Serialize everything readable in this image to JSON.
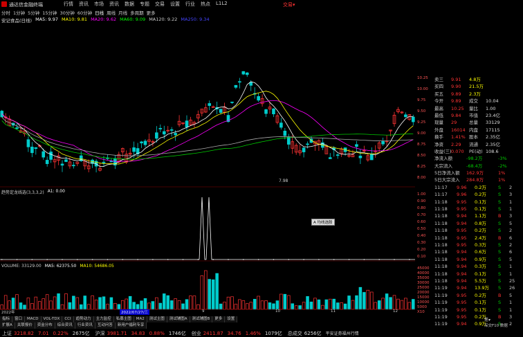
{
  "titlebar": {
    "app_title": "通达信金融终端",
    "trade": "交易▾"
  },
  "menu": {
    "items": [
      "行情",
      "资讯",
      "市场",
      "资讯",
      "数据",
      "专题",
      "交易",
      "设置",
      "行业",
      "热点",
      "L1L2"
    ]
  },
  "periods": [
    "分时",
    "1分钟",
    "5分钟",
    "15分钟",
    "30分钟",
    "60分钟",
    "日线",
    "周线",
    "月线",
    "多周期",
    "更多"
  ],
  "stock_info": {
    "name": "安记食品(日线)",
    "ma5": "MA5: 9.97",
    "ma10": "MA10: 9.81",
    "ma20": "MA20: 9.62",
    "ma60": "MA60: 9.09",
    "ma120": "MA120: 9.22",
    "ma250": "MA250: 9.34"
  },
  "indicator": {
    "title": "趋势定龙线选(3,3,3,2)",
    "a1": "A1: 0.00",
    "btn": "A 均线选股"
  },
  "volume": {
    "title": "VOLUME: 33129.00",
    "ma5": "MA5: 62375.50",
    "ma10": "MA10: 54686.05"
  },
  "chart_labels": {
    "low": "7.98",
    "date_tag": "2022/07/27/三",
    "year": "2022年",
    "m9": "9",
    "m10": "10",
    "m11": "11",
    "m12": "12"
  },
  "right_panel": {
    "ask": [
      {
        "l": "卖三",
        "p": "9.91",
        "v": "4.8万"
      },
      {
        "l": "买四",
        "p": "9.90",
        "v": "21.5万"
      },
      {
        "l": "买五",
        "p": "9.89",
        "v": "2.3万"
      }
    ],
    "info": [
      {
        "l": "今开",
        "v": "9.89",
        "l2": "成交",
        "v2": "10.04"
      },
      {
        "l": "最高",
        "v": "10.25",
        "l2": "量比",
        "v2": "1.00"
      },
      {
        "l": "最低",
        "v": "9.84",
        "l2": "市值",
        "v2": "23.4亿"
      },
      {
        "l": "现量",
        "v": "29",
        "l2": "总量",
        "v2": "33129"
      },
      {
        "l": "外盘",
        "v": "16014",
        "l2": "内盘",
        "v2": "17115"
      },
      {
        "l": "换手",
        "v": "1.41%",
        "l2": "股本",
        "v2": "2.35亿"
      },
      {
        "l": "净资",
        "v": "2.29",
        "l2": "流通",
        "v2": "2.35亿"
      },
      {
        "l": "收益(三)",
        "v": "0.070",
        "l2": "PE(动)",
        "v2": "108.6"
      }
    ],
    "flow": [
      {
        "l": "净流入额",
        "v": "-98.2万",
        "p": "-3%"
      },
      {
        "l": "大宗流入",
        "v": "-68.4万",
        "p": "-2%"
      },
      {
        "l": "5日净流入额",
        "v": "162.9万",
        "p": "1%"
      },
      {
        "l": "5日大宗流入",
        "v": "284.8万",
        "p": "1%"
      }
    ],
    "ticks": [
      {
        "t": "11:17",
        "p": "9.96",
        "v": "0.2万",
        "s": "S",
        "n": "2"
      },
      {
        "t": "11:17",
        "p": "9.96",
        "v": "0.2万",
        "s": "S",
        "n": "3"
      },
      {
        "t": "11:18",
        "p": "9.95",
        "v": "0.1万",
        "s": "S",
        "n": "1"
      },
      {
        "t": "11:18",
        "p": "9.95",
        "v": "0.1万",
        "s": "S",
        "n": "1"
      },
      {
        "t": "11:18",
        "p": "9.94",
        "v": "1.1万",
        "s": "B",
        "n": "3"
      },
      {
        "t": "11:18",
        "p": "9.94",
        "v": "0.8万",
        "s": "S",
        "n": "5"
      },
      {
        "t": "11:18",
        "p": "9.95",
        "v": "0.2万",
        "s": "S",
        "n": "2"
      },
      {
        "t": "11:18",
        "p": "9.95",
        "v": "2.4万",
        "s": "B",
        "n": "6"
      },
      {
        "t": "11:18",
        "p": "9.95",
        "v": "0.3万",
        "s": "S",
        "n": "2"
      },
      {
        "t": "11:18",
        "p": "9.94",
        "v": "0.6万",
        "s": "S",
        "n": "6"
      },
      {
        "t": "11:18",
        "p": "9.94",
        "v": "0.9万",
        "s": "S",
        "n": "5"
      },
      {
        "t": "11:18",
        "p": "9.94",
        "v": "0.3万",
        "s": "S",
        "n": "1"
      },
      {
        "t": "11:18",
        "p": "9.94",
        "v": "0.1万",
        "s": "S",
        "n": "1"
      },
      {
        "t": "11:18",
        "p": "9.94",
        "v": "5.5万",
        "s": "S",
        "n": "25"
      },
      {
        "t": "11:19",
        "p": "9.94",
        "v": "13.9万",
        "s": "S",
        "n": "26"
      },
      {
        "t": "11:19",
        "p": "9.95",
        "v": "0.2万",
        "s": "B",
        "n": "5"
      },
      {
        "t": "11:19",
        "p": "9.95",
        "v": "0.1万",
        "s": "S",
        "n": "1"
      },
      {
        "t": "11:19",
        "p": "9.95",
        "v": "0.1万",
        "s": "S",
        "n": "1"
      },
      {
        "t": "11:19",
        "p": "9.95",
        "v": "0.2万",
        "s": "B",
        "n": "3"
      },
      {
        "t": "11:19",
        "p": "9.94",
        "v": "0.9万",
        "s": "S",
        "n": "2"
      }
    ],
    "bottom_tab": "笔▾"
  },
  "price_scale": [
    "10.25",
    "10.00",
    "9.75",
    "9.50",
    "9.25",
    "9.00",
    "8.75",
    "8.50",
    "8.25",
    "8.00"
  ],
  "ind_scale": [
    "1.00",
    "0.90",
    "0.80",
    "0.70",
    "0.60",
    "0.50",
    "0.40",
    "0.30",
    "0.20",
    "0.10"
  ],
  "vol_scale": [
    "45000",
    "40000",
    "35000",
    "30000",
    "25000",
    "20000",
    "15000",
    "10000",
    "5000",
    "X10"
  ],
  "tabs1": [
    "指标",
    "窗口",
    "MACD",
    "VOL-TDX",
    "CCI",
    "趋势动力",
    "主力监控",
    "私募主图",
    "MA2",
    "测试主图",
    "测试辅图A",
    "测试辅图B",
    "更多",
    "设置"
  ],
  "tabs2": [
    "扩展A",
    "关联报价",
    "资金分布",
    "综合资讯",
    "行业资讯",
    "互动问答",
    "新用户福利专享"
  ],
  "status": {
    "sh_label": "上证",
    "sh": "3218.82",
    "sh_c": "7.01",
    "sh_p": "0.22%",
    "sh_v": "2675亿",
    "sz_label": "沪深",
    "sz": "3981.71",
    "sz_c": "34.83",
    "sz_p": "0.88%",
    "sz_v": "1746亿",
    "cy_label": "创业",
    "cy": "2411.87",
    "cy_c": "34.76",
    "cy_p": "1.46%",
    "cy_v": "1079亿",
    "total_label": "总成交",
    "total": "6256亿",
    "broker": "平安证券福州行情"
  },
  "extra": {
    "broker_tag": "深交F10 数据"
  },
  "chart_data": {
    "type": "candlestick",
    "low_label": "7.98",
    "price_range": [
      7.9,
      10.3
    ]
  }
}
